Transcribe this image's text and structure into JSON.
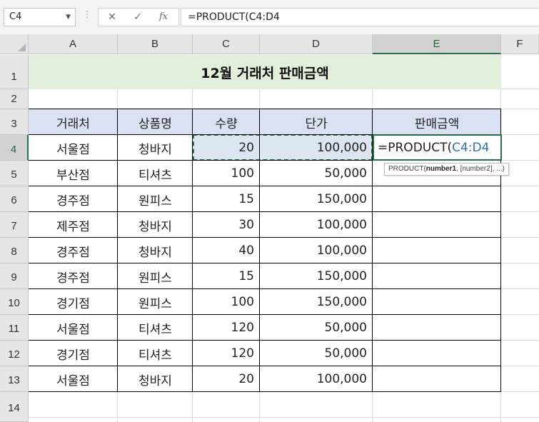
{
  "formula_bar": {
    "name_box": "C4",
    "cancel_icon": "✕",
    "enter_icon": "✓",
    "fx_icon": "fx",
    "formula": "=PRODUCT(C4:D4"
  },
  "columns": [
    "A",
    "B",
    "C",
    "D",
    "E",
    "F"
  ],
  "rows": [
    "1",
    "2",
    "3",
    "4",
    "5",
    "6",
    "7",
    "8",
    "9",
    "10",
    "11",
    "12",
    "13",
    "14"
  ],
  "selected_cell": {
    "column": "E",
    "row": "4"
  },
  "title": "12월 거래처 판매금액",
  "table": {
    "headers": [
      "거래처",
      "상품명",
      "수량",
      "단가",
      "판매금액"
    ],
    "rows": [
      [
        "서울점",
        "청바지",
        "20",
        "100,000"
      ],
      [
        "부산점",
        "티셔츠",
        "100",
        "50,000"
      ],
      [
        "경주점",
        "원피스",
        "15",
        "150,000"
      ],
      [
        "제주점",
        "청바지",
        "30",
        "100,000"
      ],
      [
        "경주점",
        "청바지",
        "40",
        "100,000"
      ],
      [
        "경주점",
        "원피스",
        "15",
        "150,000"
      ],
      [
        "경기점",
        "원피스",
        "100",
        "150,000"
      ],
      [
        "서울점",
        "티셔츠",
        "120",
        "50,000"
      ],
      [
        "경기점",
        "티셔츠",
        "120",
        "50,000"
      ],
      [
        "서울점",
        "청바지",
        "20",
        "100,000"
      ]
    ]
  },
  "edit_cell": {
    "prefix": "=PRODUCT(",
    "reference": "C4:D4"
  },
  "tooltip": {
    "fn": "PRODUCT(",
    "arg1": "number1",
    "rest": ", [number2], ...)"
  },
  "colors": {
    "title_fill": "#e2efda",
    "header_fill": "#d9e1f2",
    "selection_green": "#217346",
    "reference_blue": "#2f6fbd"
  }
}
